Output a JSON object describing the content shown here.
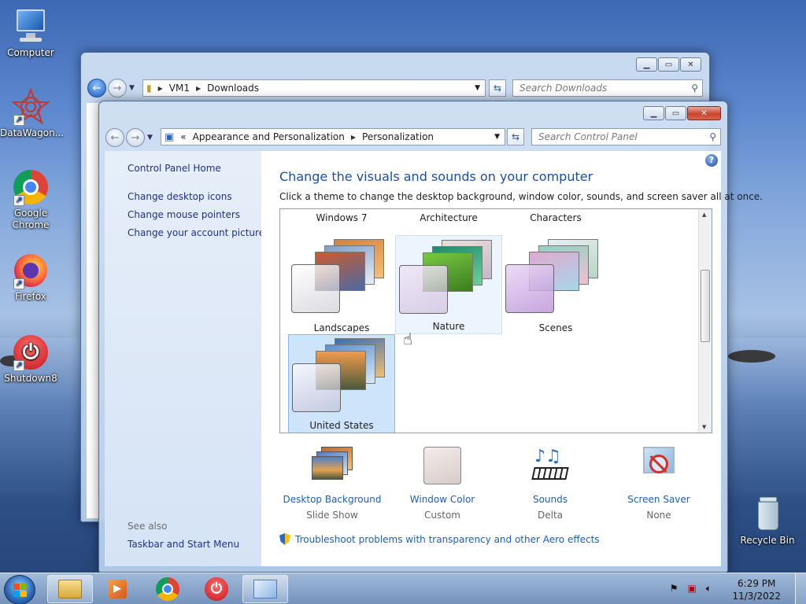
{
  "desktop": {
    "icons": [
      {
        "label": "Computer"
      },
      {
        "label": "DataWagon..."
      },
      {
        "label": "Google Chrome"
      },
      {
        "label": "Firefox"
      },
      {
        "label": "Shutdown8"
      },
      {
        "label": "Recycle Bin"
      }
    ]
  },
  "explorer": {
    "breadcrumb": [
      "VM1",
      "Downloads"
    ],
    "search_placeholder": "Search Downloads"
  },
  "control_panel": {
    "breadcrumb_prefix": "«",
    "breadcrumb": [
      "Appearance and Personalization",
      "Personalization"
    ],
    "search_placeholder": "Search Control Panel",
    "sidebar": {
      "home": "Control Panel Home",
      "links": [
        "Change desktop icons",
        "Change mouse pointers",
        "Change your account picture"
      ],
      "see_also_title": "See also",
      "see_also": [
        "Taskbar and Start Menu"
      ]
    },
    "heading": "Change the visuals and sounds on your computer",
    "instructions": "Click a theme to change the desktop background, window color, sounds, and screen saver all at once.",
    "themes": [
      {
        "name": "Windows 7"
      },
      {
        "name": "Architecture"
      },
      {
        "name": "Characters"
      },
      {
        "name": "Landscapes"
      },
      {
        "name": "Nature"
      },
      {
        "name": "Scenes"
      },
      {
        "name": "United States"
      }
    ],
    "settings": [
      {
        "label": "Desktop Background",
        "value": "Slide Show"
      },
      {
        "label": "Window Color",
        "value": "Custom"
      },
      {
        "label": "Sounds",
        "value": "Delta"
      },
      {
        "label": "Screen Saver",
        "value": "None"
      }
    ],
    "troubleshoot_link": "Troubleshoot problems with transparency and other Aero effects"
  },
  "taskbar": {
    "time": "6:29 PM",
    "date": "11/3/2022"
  },
  "colors": {
    "link": "#1e5fb6",
    "heading": "#1e4ea0",
    "selected_theme": "#cde4fb"
  }
}
